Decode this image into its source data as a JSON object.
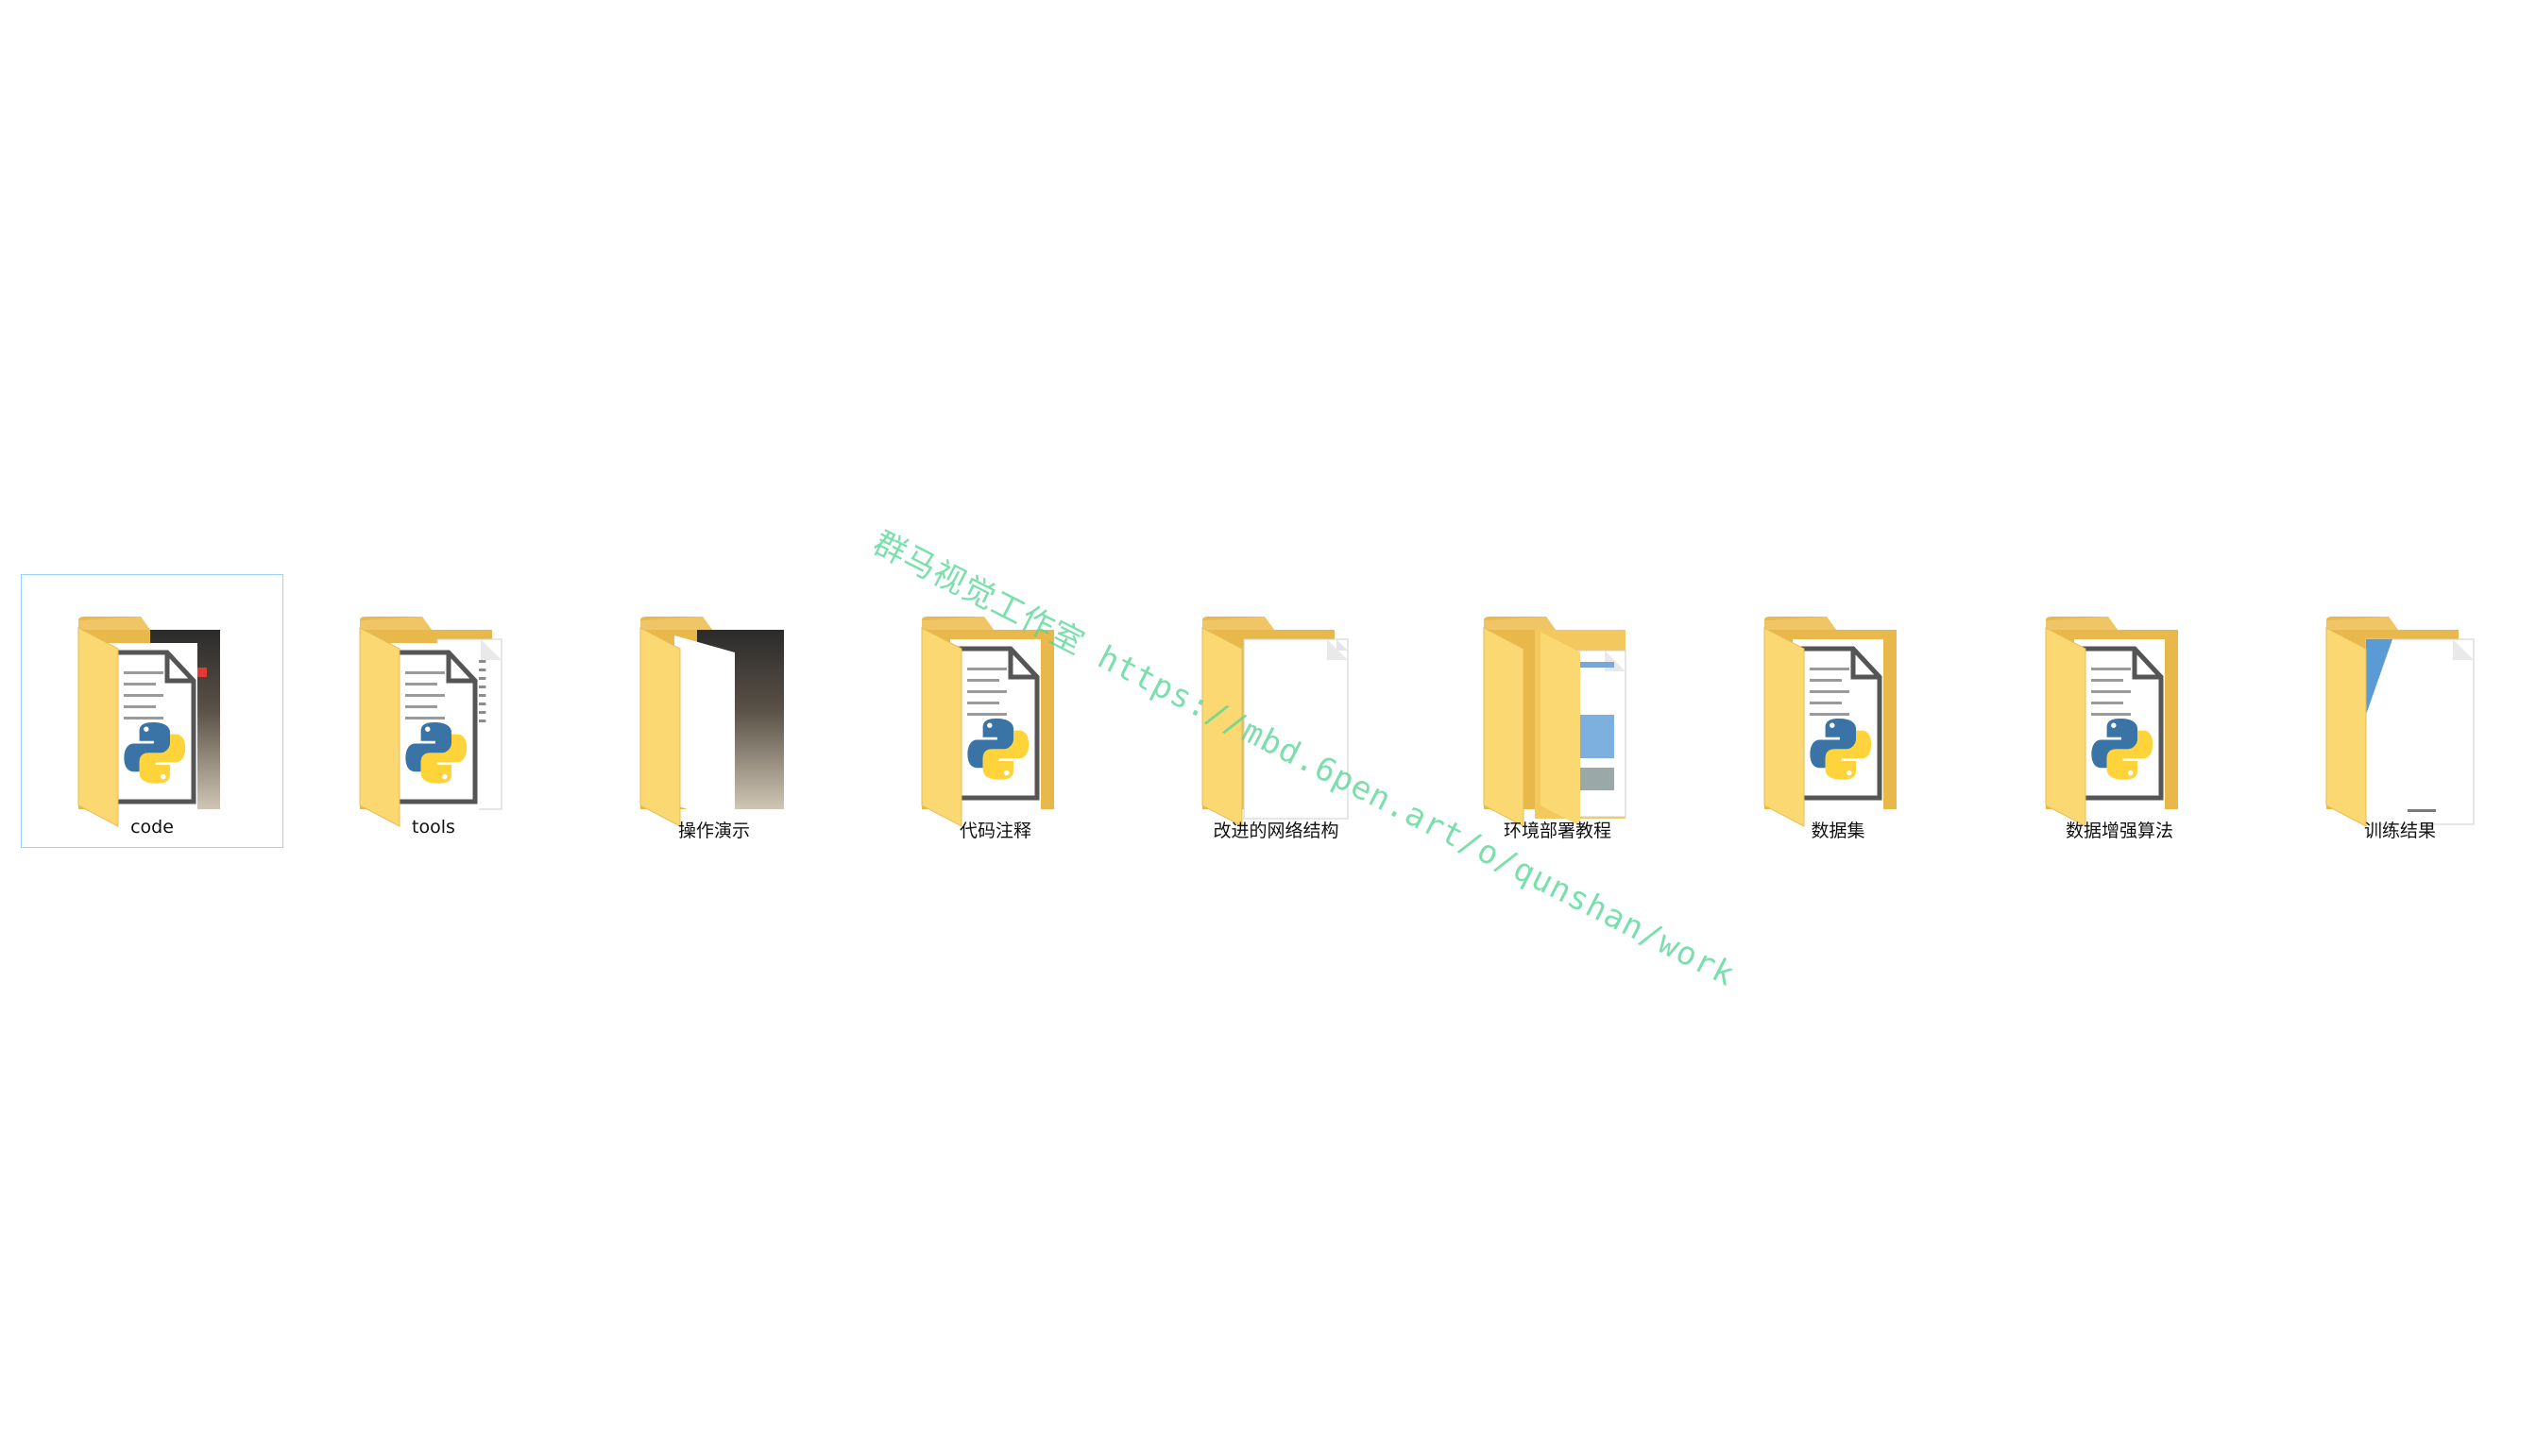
{
  "folders": [
    {
      "label": "code",
      "preview": "python-photo",
      "selected": true
    },
    {
      "label": "tools",
      "preview": "python-doc",
      "selected": false
    },
    {
      "label": "操作演示",
      "preview": "photo",
      "selected": false
    },
    {
      "label": "代码注释",
      "preview": "python",
      "selected": false
    },
    {
      "label": "改进的网络结构",
      "preview": "blank-doc",
      "selected": false
    },
    {
      "label": "环境部署教程",
      "preview": "image-doc",
      "selected": false
    },
    {
      "label": "数据集",
      "preview": "python",
      "selected": false
    },
    {
      "label": "数据增强算法",
      "preview": "python",
      "selected": false
    },
    {
      "label": "训练结果",
      "preview": "chart-doc",
      "selected": false
    }
  ],
  "watermark": "群马视觉工作室 https://mbd.6pen.art/o/qunshan/work",
  "colors": {
    "folder_back": "#E8B84A",
    "folder_front": "#FCD873",
    "python_blue": "#3A73A6",
    "python_yellow": "#FFD43B",
    "selection_border": "#99d1ff",
    "watermark": "#56D696"
  }
}
